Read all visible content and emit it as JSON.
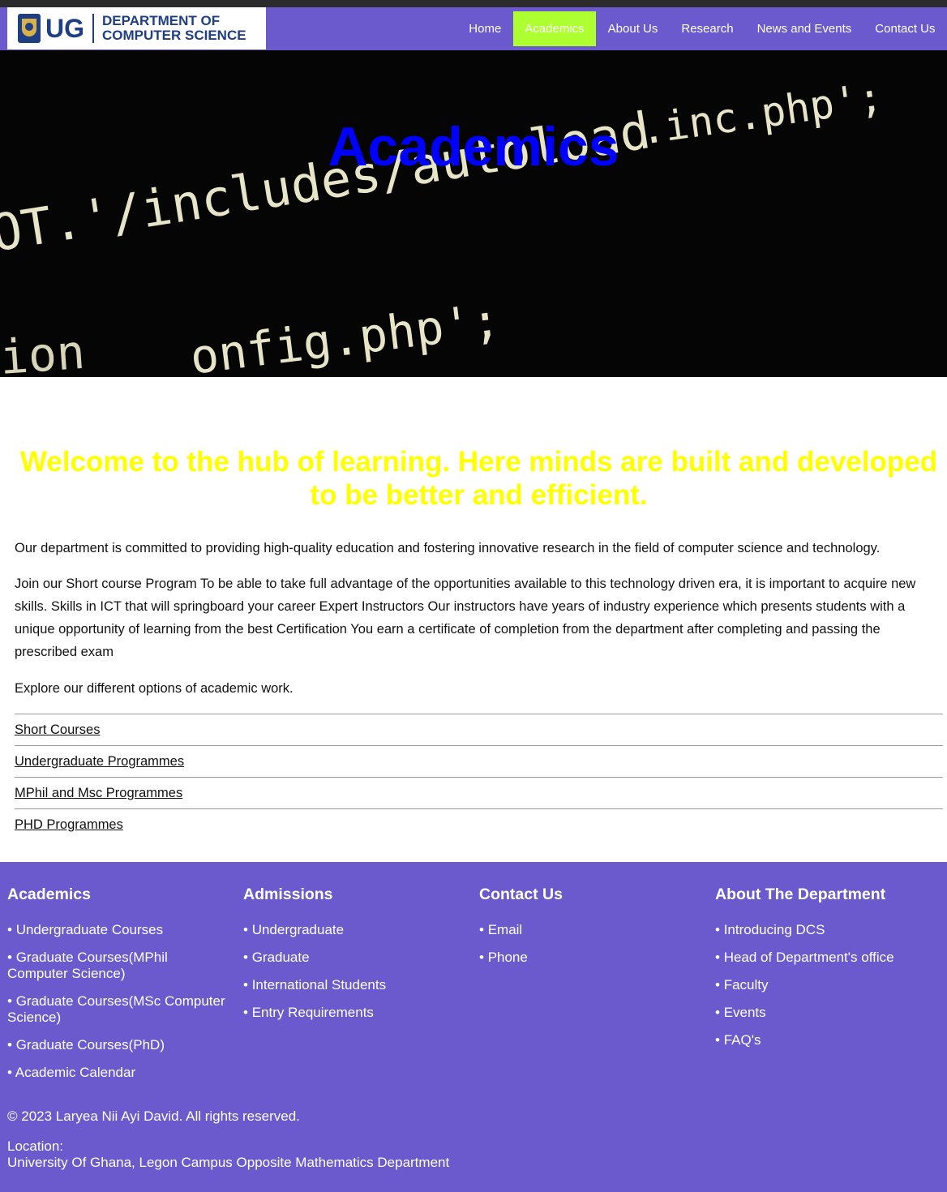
{
  "header": {
    "logo_ug": "UG",
    "logo_dept_line1": "DEPARTMENT OF",
    "logo_dept_line2": "COMPUTER SCIENCE",
    "nav": [
      {
        "label": "Home"
      },
      {
        "label": "Academics",
        "active": true
      },
      {
        "label": "About Us"
      },
      {
        "label": "Research"
      },
      {
        "label": "News and Events"
      },
      {
        "label": "Contact Us"
      }
    ]
  },
  "hero": {
    "title": "Academics",
    "code_lines": [
      ".inc.php';",
      "OT.'/includes/autoload",
      "ion",
      "onfig.php';"
    ]
  },
  "main": {
    "welcome": "Welcome to the hub of learning. Here minds are built and developed to be better and efficient.",
    "paragraph1": "Our department is committed to providing high-quality education and fostering innovative research in the field of computer science and technology.",
    "paragraph2": "Join our Short course Program To be able to take full advantage of the opportunities available to this technology driven era, it is important to acquire new skills. Skills in ICT that will springboard your career Expert Instructors Our instructors have years of industry experience which presents students with a unique opportunity of learning from the best Certification You earn a certificate of completion from the department after completing and passing the prescribed exam",
    "paragraph3": "Explore our different options of academic work.",
    "options": [
      "Short Courses",
      "Undergraduate Programmes",
      "MPhil and Msc Programmes",
      "PHD Programmes"
    ]
  },
  "footer": {
    "academics": {
      "title": "Academics",
      "items": [
        "Undergraduate Courses",
        "Graduate Courses(MPhil Computer Science)",
        "Graduate Courses(MSc Computer Science)",
        "Graduate Courses(PhD)",
        "Academic Calendar"
      ]
    },
    "admissions": {
      "title": "Admissions",
      "items": [
        "Undergraduate",
        "Graduate",
        "International Students",
        "Entry Requirements"
      ]
    },
    "contact": {
      "title": "Contact Us",
      "items": [
        "Email",
        "Phone"
      ]
    },
    "about": {
      "title": "About The Department",
      "items": [
        "Introducing DCS",
        "Head of Department's office",
        "Faculty",
        "Events",
        "FAQ's"
      ]
    },
    "copyright": "© 2023 Laryea Nii Ayi David. All rights reserved.",
    "location_label": "Location:",
    "location_text": "University Of Ghana, Legon Campus Opposite Mathematics Department"
  },
  "colors": {
    "brand_purple": "#6a5acd",
    "active_nav": "#adff2f",
    "hero_title": "#0000ff",
    "welcome_text": "#ffff00"
  }
}
